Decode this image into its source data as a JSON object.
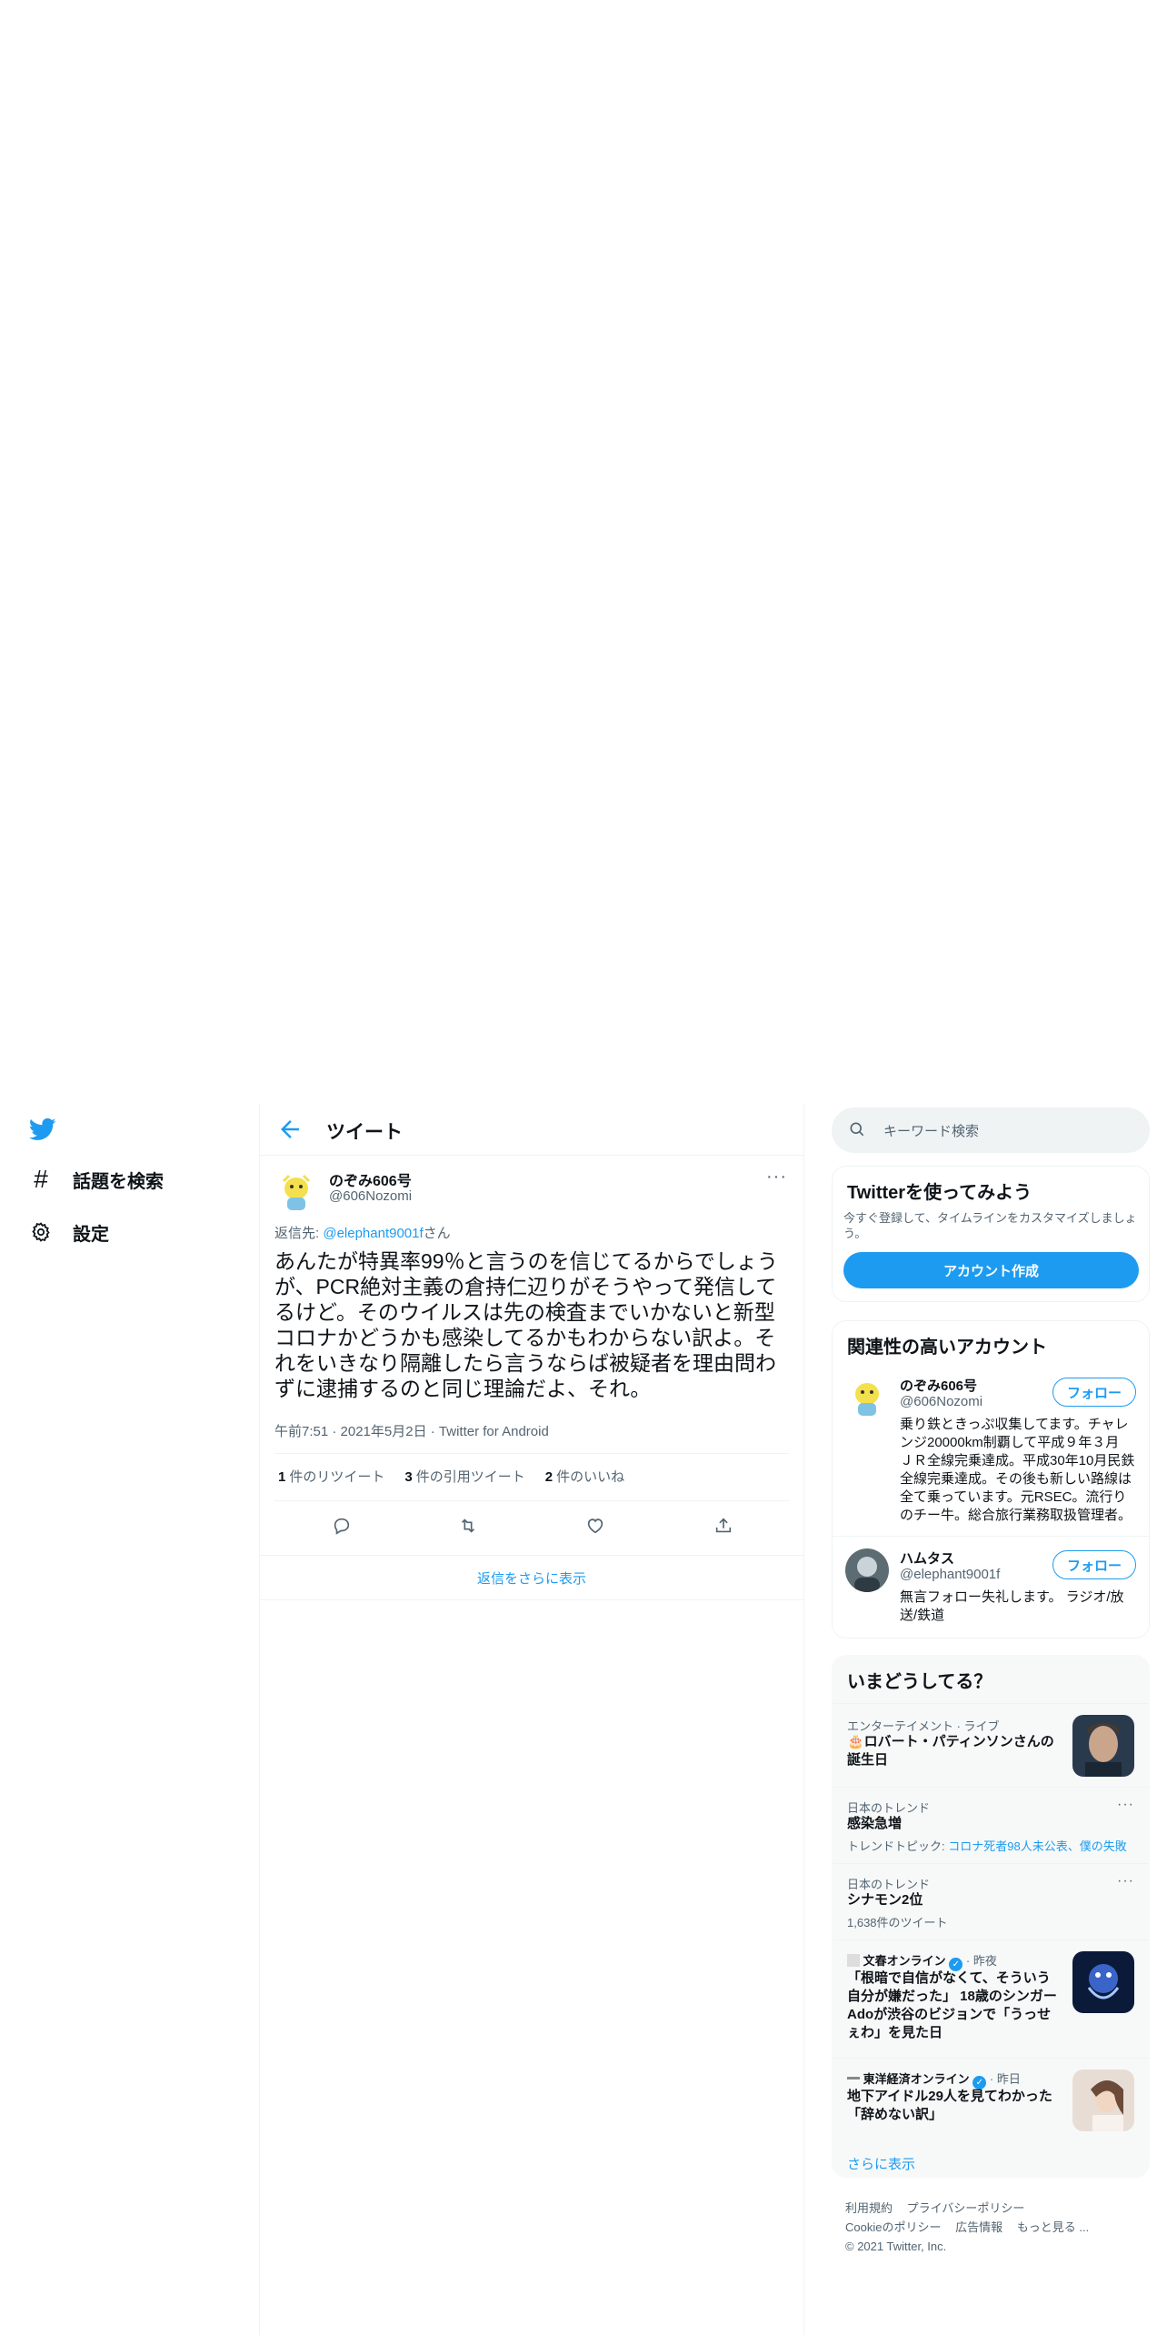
{
  "nav": {
    "items": [
      {
        "icon": "hash-icon",
        "label": "話題を検索"
      },
      {
        "icon": "gear-icon",
        "label": "設定"
      }
    ]
  },
  "header": {
    "title": "ツイート"
  },
  "tweet": {
    "name": "のぞみ606号",
    "handle": "@606Nozomi",
    "reply_prefix": "返信先: ",
    "reply_to": "@elephant9001f",
    "reply_suffix": "さん",
    "text": "あんたが特異率99％と言うのを信じてるからでしょうが、PCR絶対主義の倉持仁辺りがそうやって発信してるけど。そのウイルスは先の検査までいかないと新型コロナかどうかも感染してるかもわからない訳よ。それをいきなり隔離したら言うならば被疑者を理由問わずに逮捕するのと同じ理論だよ、それ。",
    "meta": "午前7:51 · 2021年5月2日 · Twitter for Android",
    "retweets_count": "1",
    "retweets_label": "件のリツイート",
    "quotes_count": "3",
    "quotes_label": "件の引用ツイート",
    "likes_count": "2",
    "likes_label": "件のいいね",
    "more_replies": "返信をさらに表示"
  },
  "search": {
    "placeholder": "キーワード検索"
  },
  "signup": {
    "title": "Twitterを使ってみよう",
    "desc": "今すぐ登録して、タイムラインをカスタマイズしましょう。",
    "button": "アカウント作成"
  },
  "related": {
    "title": "関連性の高いアカウント",
    "follow_label": "フォロー",
    "accounts": [
      {
        "name": "のぞみ606号",
        "handle": "@606Nozomi",
        "bio": "乗り鉄ときっぷ収集してます。チャレンジ20000km制覇して平成９年３月 ＪＲ全線完乗達成。平成30年10月民鉄全線完乗達成。その後も新しい路線は全て乗っています。元RSEC。流行りのチー牛。総合旅行業務取扱管理者。"
      },
      {
        "name": "ハムタス",
        "handle": "@elephant9001f",
        "bio": "無言フォロー失礼します。 ラジオ/放送/鉄道"
      }
    ]
  },
  "trends": {
    "title": "いまどうしてる？",
    "items": [
      {
        "context": "エンターテイメント · ライブ",
        "title": "🎂ロバート・パティンソンさんの誕生日"
      },
      {
        "context": "日本のトレンド",
        "title": "感染急増",
        "sub_prefix": "トレンドトピック: ",
        "sub_link": "コロナ死者98人未公表、僕の失敗"
      },
      {
        "context": "日本のトレンド",
        "title": "シナモン2位",
        "sub": "1,638件のツイート"
      },
      {
        "source": "文春オンライン",
        "time": " · 昨夜",
        "title": "「根暗で自信がなくて、そういう自分が嫌だった」 18歳のシンガーAdoが渋谷のビジョンで「うっせぇわ」を見た日"
      },
      {
        "source": "東洋経済オンライン",
        "time": " · 昨日",
        "title": "地下アイドル29人を見てわかった「辞めない訳」"
      }
    ],
    "show_more": "さらに表示"
  },
  "footer": {
    "links": [
      "利用規約",
      "プライバシーポリシー",
      "Cookieのポリシー",
      "広告情報",
      "もっと見る ..."
    ],
    "copyright": "© 2021 Twitter, Inc."
  },
  "colors": {
    "accent": "#1d9bf0",
    "text": "#0f1419",
    "secondary": "#536471"
  }
}
